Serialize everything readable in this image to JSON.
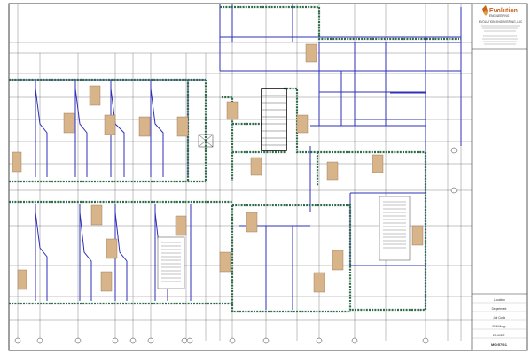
{
  "title_block": {
    "company_name": "Evolution",
    "company_subtitle": "ENGINEERING",
    "address_lines": [
      "EVOLUTION ENGINEERING, LLC",
      "",
      "",
      ""
    ],
    "notes_lines": [
      "",
      "",
      "",
      "",
      "",
      ""
    ],
    "project_lines": [
      "Location",
      "Department",
      "Job Code",
      "FM Village",
      "20160227"
    ],
    "drawing_number": "M02579-1"
  },
  "plan_notes": {
    "note_block_1": [
      "",
      "",
      "",
      "",
      "",
      "",
      "",
      "",
      "",
      "",
      "",
      ""
    ],
    "note_block_2": [
      "",
      "",
      "",
      "",
      "",
      "",
      "",
      "",
      "",
      "",
      "",
      "",
      "",
      ""
    ]
  },
  "colors": {
    "wall_blue": "#2f2fb8",
    "wall_green": "#2e6b4a",
    "room_tag": "#d7b48a",
    "grid_line": "#444444",
    "brand_orange": "#c8621b"
  }
}
